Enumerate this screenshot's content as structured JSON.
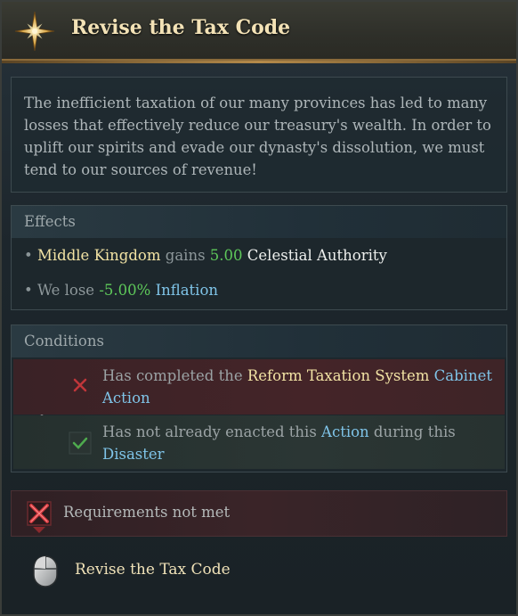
{
  "header": {
    "title": "Revise the Tax Code",
    "icon": "compass-star-icon"
  },
  "description": "The inefficient taxation of our many provinces has led to many losses that effectively reduce our treasury's wealth. In order to uplift our spirits and evade our dynasty's dissolution, we must tend to our sources of revenue!",
  "effects": {
    "heading": "Effects",
    "line1": {
      "bullet": "•",
      "subject": "Middle Kingdom",
      "verb": "gains",
      "value": "5.00",
      "resource": "Celestial Authority"
    },
    "line2": {
      "bullet": "•",
      "prefix": "We lose",
      "value": "-5.00%",
      "resource": "Inflation"
    }
  },
  "conditions": {
    "heading": "Conditions",
    "items": [
      {
        "status": "failed",
        "prefix": "Has completed the",
        "highlight1": "Reform Taxation System",
        "highlight2": "Cabinet Action"
      },
      {
        "status": "met",
        "prefix": "Has not already enacted this",
        "highlight1": "Action",
        "middle": "during this",
        "highlight2": "Disaster"
      }
    ]
  },
  "requirements": {
    "label": "Requirements not met",
    "icon": "cross-icon"
  },
  "action": {
    "label": "Revise the Tax Code",
    "icon": "mouse-icon"
  },
  "colors": {
    "gold": "#f2e3a4",
    "positive": "#5ec85a",
    "link": "#7fc4e8",
    "fail_bg": "#442428",
    "title": "#f3e2b6"
  }
}
